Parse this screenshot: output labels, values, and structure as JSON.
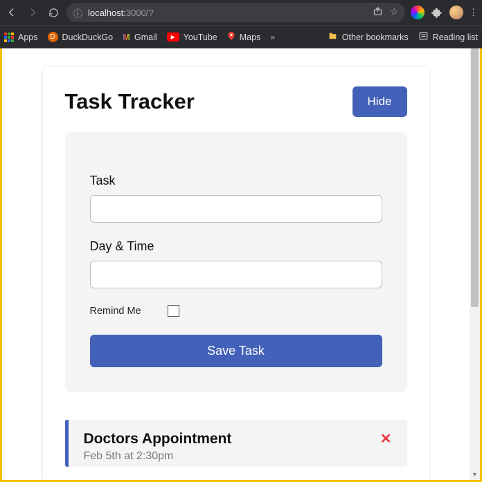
{
  "browser": {
    "url_host": "localhost:",
    "url_rest": "3000/?",
    "bookmarks": {
      "apps": "Apps",
      "duck": "DuckDuckGo",
      "gmail": "Gmail",
      "youtube": "YouTube",
      "maps": "Maps",
      "other": "Other bookmarks",
      "reading": "Reading list"
    }
  },
  "app": {
    "title": "Task Tracker",
    "toggle_button": "Hide"
  },
  "form": {
    "task_label": "Task",
    "task_value": "",
    "daytime_label": "Day & Time",
    "daytime_value": "",
    "remind_label": "Remind Me",
    "remind_checked": false,
    "submit_label": "Save Task"
  },
  "tasks": [
    {
      "title": "Doctors Appointment",
      "time": "Feb 5th at 2:30pm"
    }
  ]
}
